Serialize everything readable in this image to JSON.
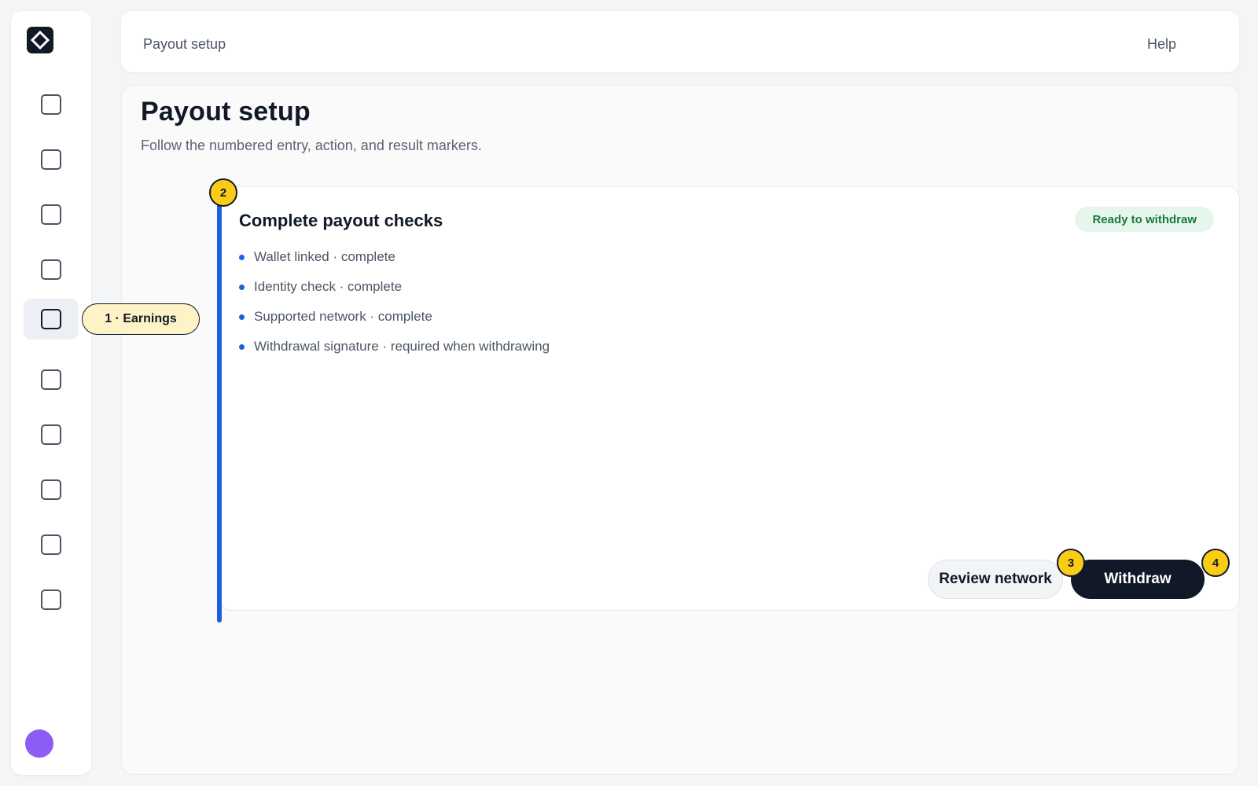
{
  "header": {
    "title": "Payout setup",
    "help_label": "Help"
  },
  "sidebar": {
    "logo_icon": "diamond-logo-icon",
    "items": [
      {
        "icon": "nav-square-icon",
        "active": false
      },
      {
        "icon": "nav-square-icon",
        "active": false
      },
      {
        "icon": "nav-square-icon",
        "active": false
      },
      {
        "icon": "nav-square-icon",
        "active": false
      },
      {
        "icon": "nav-square-icon",
        "active": true
      },
      {
        "icon": "nav-square-icon",
        "active": false
      },
      {
        "icon": "nav-square-icon",
        "active": false
      },
      {
        "icon": "nav-square-icon",
        "active": false
      },
      {
        "icon": "nav-square-icon",
        "active": false
      },
      {
        "icon": "nav-square-icon",
        "active": false
      }
    ],
    "avatar_color": "#8b5cf6"
  },
  "page": {
    "title": "Payout setup",
    "subtitle": "Follow the numbered entry, action, and result markers."
  },
  "card": {
    "title": "Complete payout checks",
    "status": "Ready to withdraw",
    "checks": [
      "Wallet linked · complete",
      "Identity check · complete",
      "Supported network · complete",
      "Withdrawal signature · required when withdrawing"
    ],
    "review_button": "Review network",
    "withdraw_button": "Withdraw"
  },
  "markers": {
    "entry_label": "1 · Earnings",
    "step2": "2",
    "step3": "3",
    "step4": "4"
  },
  "colors": {
    "accent": "#1d5fe0",
    "marker": "#facc15",
    "success_bg": "#e7f6ec",
    "success_text": "#1a7a3a",
    "primary_button": "#111827"
  }
}
